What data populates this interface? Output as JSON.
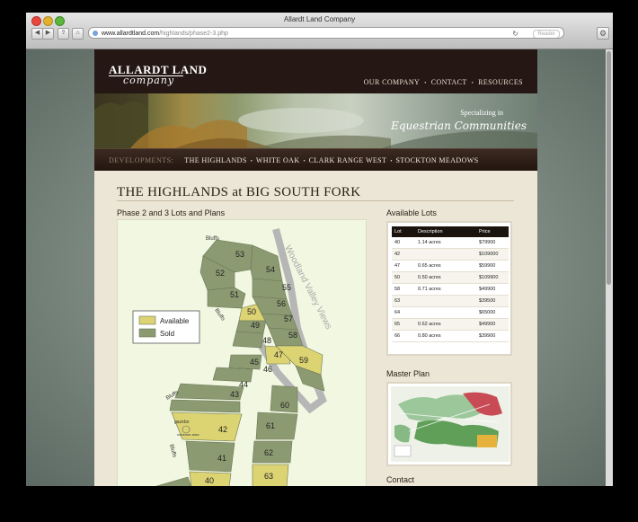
{
  "window": {
    "title": "Allardt Land Company"
  },
  "browser": {
    "url_domain": "www.allardtland.com",
    "url_path": "/highlands/phase2-3.php",
    "reader_label": "Reader",
    "back_glyph": "◀",
    "forward_glyph": "▶",
    "share_glyph": "⇪",
    "home_glyph": "⌂",
    "reload_glyph": "↻",
    "gear_glyph": "⚙"
  },
  "site": {
    "logo_top": "ALLARDT LAND",
    "logo_bottom": "company",
    "top_nav": [
      "OUR COMPANY",
      "CONTACT",
      "RESOURCES"
    ],
    "nav_bullet": "•",
    "banner_line1": "Specializing in",
    "banner_line2": "Equestrian Communities",
    "dev_label": "DEVELOPMENTS:",
    "dev_links": [
      "THE HIGHLANDS",
      "WHITE OAK",
      "CLARK RANGE WEST",
      "STOCKTON MEADOWS"
    ]
  },
  "main": {
    "title": "THE HIGHLANDS at BIG SOUTH FORK",
    "map_heading": "Phase 2 and 3 Lots and Plans",
    "lots_heading": "Available Lots",
    "master_plan_heading": "Master Plan",
    "contact_heading": "Contact"
  },
  "map": {
    "legend": {
      "available": "Available",
      "sold": "Sold"
    },
    "labels": {
      "bluffs": "Bluffs",
      "road": "Woodland Valley Views",
      "gazebo": "gazebo",
      "common": "common area"
    },
    "lot_numbers": [
      "53",
      "52",
      "54",
      "51",
      "55",
      "50",
      "56",
      "49",
      "57",
      "48",
      "58",
      "47",
      "59",
      "46",
      "45",
      "44",
      "43",
      "42",
      "60",
      "61",
      "41",
      "62",
      "40",
      "63"
    ],
    "colors": {
      "available": "#dcd373",
      "sold": "#8c9a72",
      "background": "#f1f7e0"
    }
  },
  "lots_table": {
    "headers": [
      "Lot",
      "Description",
      "Price"
    ],
    "rows": [
      [
        "40",
        "1.14 acres",
        "$79900"
      ],
      [
        "42",
        "",
        "$109000"
      ],
      [
        "47",
        "0.65 acres",
        "$59900"
      ],
      [
        "50",
        "0.50 acres",
        "$109900"
      ],
      [
        "58",
        "0.71 acres",
        "$49900"
      ],
      [
        "63",
        "",
        "$39500"
      ],
      [
        "64",
        "",
        "$65000"
      ],
      [
        "65",
        "0.62 acres",
        "$49900"
      ],
      [
        "66",
        "0.80 acres",
        "$39900"
      ]
    ]
  }
}
